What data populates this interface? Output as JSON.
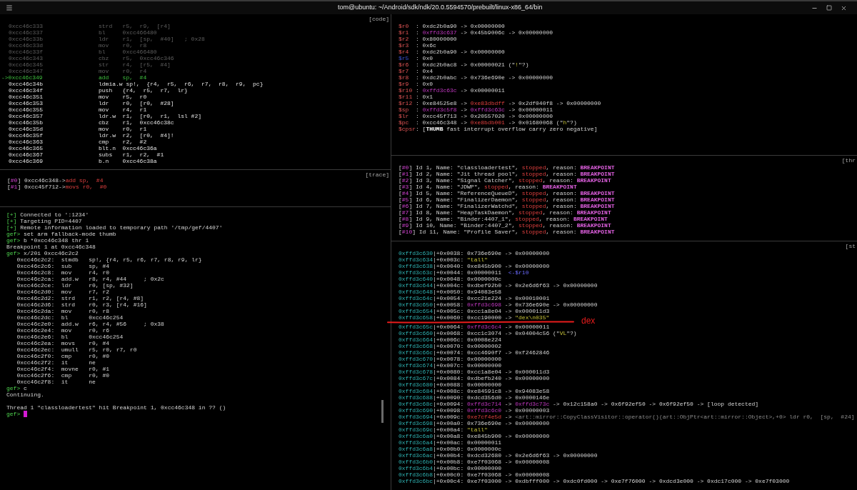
{
  "window": {
    "title": "tom@ubuntu: ~/Android/sdk/ndk/20.0.5594570/prebuilt/linux-x86_64/bin"
  },
  "code_pane": {
    "label": "[code]",
    "lines": [
      {
        "address": "0xcc46c333",
        "instruction": "strd   r5,  r9,  [r4]",
        "kind": "past"
      },
      {
        "address": "0xcc46c337",
        "instruction": "bl     0xcc466480",
        "kind": "past"
      },
      {
        "address": "0xcc46c33b",
        "instruction": "ldr    r1,  [sp,  #40]   ; 0x28",
        "kind": "past"
      },
      {
        "address": "0xcc46c33d",
        "instruction": "mov    r0,  r8",
        "kind": "past"
      },
      {
        "address": "0xcc46c33f",
        "instruction": "bl     0xcc466480",
        "kind": "past"
      },
      {
        "address": "0xcc46c343",
        "instruction": "cbz    r5,  0xcc46c346",
        "kind": "past"
      },
      {
        "address": "0xcc46c345",
        "instruction": "str    r4,  [r5,  #4]",
        "kind": "past"
      },
      {
        "address": "0xcc46c347",
        "instruction": "mov    r0,  r4",
        "kind": "past"
      },
      {
        "address": "->0xcc46c349",
        "instruction": "add    sp,  #4",
        "kind": "current"
      },
      {
        "address": "0xcc46c34b",
        "instruction": "ldmia.w sp!,  {r4,  r5,  r6,  r7,  r8,  r9,  pc}",
        "kind": "next"
      },
      {
        "address": "0xcc46c34f",
        "instruction": "push   {r4,  r5,  r7,  lr}",
        "kind": "next"
      },
      {
        "address": "0xcc46c351",
        "instruction": "mov    r5,  r0",
        "kind": "next"
      },
      {
        "address": "0xcc46c353",
        "instruction": "ldr    r0,  [r0,  #28]",
        "kind": "next"
      },
      {
        "address": "0xcc46c355",
        "instruction": "mov    r4,  r1",
        "kind": "next"
      },
      {
        "address": "0xcc46c357",
        "instruction": "ldr.w  r1,  [r0,  r1,  lsl #2]",
        "kind": "next"
      },
      {
        "address": "0xcc46c35b",
        "instruction": "cbz    r1,  0xcc46c38c",
        "kind": "next"
      },
      {
        "address": "0xcc46c35d",
        "instruction": "mov    r0,  r1",
        "kind": "next"
      },
      {
        "address": "0xcc46c35f",
        "instruction": "ldr.w  r2,  [r0,  #4]!",
        "kind": "next"
      },
      {
        "address": "0xcc46c363",
        "instruction": "cmp    r2,  #2",
        "kind": "next"
      },
      {
        "address": "0xcc46c365",
        "instruction": "blt.n  0xcc46c36a",
        "kind": "next"
      },
      {
        "address": "0xcc46c367",
        "instruction": "subs   r1,  r2,  #1",
        "kind": "next"
      },
      {
        "address": "0xcc46c369",
        "instruction": "b.n    0xcc46c38a",
        "kind": "next"
      }
    ]
  },
  "trace_pane": {
    "label": "[trace]",
    "lines": [
      [
        {
          "kind": "plain",
          "text": "["
        },
        {
          "kind": "index",
          "text": "#0"
        },
        {
          "kind": "plain",
          "text": "] 0xcc46c348->"
        },
        {
          "kind": "code",
          "text": "add sp,  #4"
        }
      ],
      [
        {
          "kind": "plain",
          "text": "["
        },
        {
          "kind": "index",
          "text": "#1"
        },
        {
          "kind": "plain",
          "text": "] 0xcc45f712->"
        },
        {
          "kind": "code",
          "text": "movs r0,  #0"
        }
      ]
    ]
  },
  "console": {
    "lines": [
      [
        {
          "kind": "ok",
          "text": "[+]"
        },
        {
          "kind": "plain",
          "text": " Connected to ':1234'"
        }
      ],
      [
        {
          "kind": "ok",
          "text": "[+]"
        },
        {
          "kind": "plain",
          "text": " Targeting PID=4407"
        }
      ],
      [
        {
          "kind": "ok",
          "text": "[+]"
        },
        {
          "kind": "plain",
          "text": " Remote information loaded to temporary path '/tmp/gef/4407'"
        }
      ],
      [
        {
          "kind": "ok",
          "text": "gef>"
        },
        {
          "kind": "plain",
          "text": " set arm fallback-mode thumb"
        }
      ],
      [
        {
          "kind": "ok",
          "text": "gef>"
        },
        {
          "kind": "plain",
          "text": " b *0xcc46c348 thr 1"
        }
      ],
      [
        {
          "kind": "plain",
          "text": "Breakpoint 1 at 0xcc46c348"
        }
      ],
      [
        {
          "kind": "ok",
          "text": "gef>"
        },
        {
          "kind": "plain",
          "text": " x/20i 0xcc46c2c2"
        }
      ],
      [
        {
          "kind": "plain",
          "text": "   0xcc46c2c2:  stmdb   sp!, {r4, r5, r6, r7, r8, r9, lr}"
        }
      ],
      [
        {
          "kind": "plain",
          "text": "   0xcc46c2c6:  sub     sp, #4"
        }
      ],
      [
        {
          "kind": "plain",
          "text": "   0xcc46c2c8:  mov     r4, r0"
        }
      ],
      [
        {
          "kind": "plain",
          "text": "   0xcc46c2ca:  add.w   r8, r4, #44     ; 0x2c"
        }
      ],
      [
        {
          "kind": "plain",
          "text": "   0xcc46c2ce:  ldr     r0, [sp, #32]"
        }
      ],
      [
        {
          "kind": "plain",
          "text": "   0xcc46c2d0:  mov     r7, r2"
        }
      ],
      [
        {
          "kind": "plain",
          "text": "   0xcc46c2d2:  strd    r1, r2, [r4, #8]"
        }
      ],
      [
        {
          "kind": "plain",
          "text": "   0xcc46c2d6:  strd    r0, r3, [r4, #16]"
        }
      ],
      [
        {
          "kind": "plain",
          "text": "   0xcc46c2da:  mov     r0, r8"
        }
      ],
      [
        {
          "kind": "plain",
          "text": "   0xcc46c2dc:  bl      0xcc46c254"
        }
      ],
      [
        {
          "kind": "plain",
          "text": "   0xcc46c2e0:  add.w   r6, r4, #56     ; 0x38"
        }
      ],
      [
        {
          "kind": "plain",
          "text": "   0xcc46c2e4:  mov     r0, r6"
        }
      ],
      [
        {
          "kind": "plain",
          "text": "   0xcc46c2e6:  bl      0xcc46c254"
        }
      ],
      [
        {
          "kind": "plain",
          "text": "   0xcc46c2ea:  movs    r0, #4"
        }
      ],
      [
        {
          "kind": "plain",
          "text": "   0xcc46c2ec:  umull   r5, r0, r7, r0"
        }
      ],
      [
        {
          "kind": "plain",
          "text": "   0xcc46c2f0:  cmp     r0, #0"
        }
      ],
      [
        {
          "kind": "plain",
          "text": "   0xcc46c2f2:  it      ne"
        }
      ],
      [
        {
          "kind": "plain",
          "text": "   0xcc46c2f4:  movne   r0, #1"
        }
      ],
      [
        {
          "kind": "plain",
          "text": "   0xcc46c2f6:  cmp     r0, #0"
        }
      ],
      [
        {
          "kind": "plain",
          "text": "   0xcc46c2f8:  it      ne"
        }
      ],
      [
        {
          "kind": "ok",
          "text": "gef>"
        },
        {
          "kind": "plain",
          "text": " c"
        }
      ],
      [
        {
          "kind": "plain",
          "text": "Continuing."
        }
      ]
    ],
    "status": [
      {
        "kind": "plain",
        "text": "Thread 1 \"classloadertest\" hit Breakpoint 1, 0xcc46c348 in ?? ()"
      }
    ],
    "prompt": "gef>"
  },
  "registers": {
    "lines": [
      [
        {
          "kind": "reg",
          "text": "$r0  "
        },
        {
          "kind": "plain",
          "text": ": 0xdc2b0a90 -> 0x00000000"
        }
      ],
      [
        {
          "kind": "reg",
          "text": "$r1  "
        },
        {
          "kind": "plain",
          "text": ": "
        },
        {
          "kind": "heap",
          "text": "0xffd3c637"
        },
        {
          "kind": "plain",
          "text": " -> 0x45b9006c -> 0x00000000"
        }
      ],
      [
        {
          "kind": "reg",
          "text": "$r2  "
        },
        {
          "kind": "plain",
          "text": ": 0x80000000"
        }
      ],
      [
        {
          "kind": "reg",
          "text": "$r3  "
        },
        {
          "kind": "plain",
          "text": ": 0x6c"
        }
      ],
      [
        {
          "kind": "reg",
          "text": "$r4  "
        },
        {
          "kind": "plain",
          "text": ": 0xdc2b0a90 -> 0x00000000"
        }
      ],
      [
        {
          "kind": "changed",
          "text": "$r5  "
        },
        {
          "kind": "plain",
          "text": ": 0x0"
        }
      ],
      [
        {
          "kind": "reg",
          "text": "$r6  "
        },
        {
          "kind": "plain",
          "text": ": 0xdc2b0ac8 -> 0x00000021 (\""
        },
        {
          "kind": "string",
          "text": "!"
        },
        {
          "kind": "plain",
          "text": "\"?)"
        }
      ],
      [
        {
          "kind": "reg",
          "text": "$r7  "
        },
        {
          "kind": "plain",
          "text": ": 0x4"
        }
      ],
      [
        {
          "kind": "reg",
          "text": "$r8  "
        },
        {
          "kind": "plain",
          "text": ": 0xdc2b0abc -> 0x736e690e -> 0x00000000"
        }
      ],
      [
        {
          "kind": "reg",
          "text": "$r9  "
        },
        {
          "kind": "plain",
          "text": ": 0x0"
        }
      ],
      [
        {
          "kind": "reg",
          "text": "$r10 "
        },
        {
          "kind": "plain",
          "text": ": "
        },
        {
          "kind": "heap",
          "text": "0xffd3c63c"
        },
        {
          "kind": "plain",
          "text": " -> 0x00000011"
        }
      ],
      [
        {
          "kind": "reg",
          "text": "$r11 "
        },
        {
          "kind": "plain",
          "text": ": 0x1"
        }
      ],
      [
        {
          "kind": "reg",
          "text": "$r12 "
        },
        {
          "kind": "plain",
          "text": ": 0xe84525e8 -> "
        },
        {
          "kind": "code",
          "text": "0xe83dbdff"
        },
        {
          "kind": "plain",
          "text": " -> 0x2df040f8 -> 0x00000000"
        }
      ],
      [
        {
          "kind": "reg",
          "text": "$sp  "
        },
        {
          "kind": "plain",
          "text": ": "
        },
        {
          "kind": "heap",
          "text": "0xffd3c5f8"
        },
        {
          "kind": "plain",
          "text": " -> "
        },
        {
          "kind": "heap",
          "text": "0xffd3c63c"
        },
        {
          "kind": "plain",
          "text": " -> 0x00000011"
        }
      ],
      [
        {
          "kind": "reg",
          "text": "$lr  "
        },
        {
          "kind": "plain",
          "text": ": 0xcc45f713 -> 0x20557020 -> 0x00000000"
        }
      ],
      [
        {
          "kind": "reg",
          "text": "$pc  "
        },
        {
          "kind": "plain",
          "text": ": 0xcc46c348 -> "
        },
        {
          "kind": "code",
          "text": "0xe8bdb001"
        },
        {
          "kind": "plain",
          "text": " -> 0x01680068 (\""
        },
        {
          "kind": "string",
          "text": "h"
        },
        {
          "kind": "plain",
          "text": "\"?)"
        }
      ],
      [
        {
          "kind": "reg",
          "text": "$cpsr"
        },
        {
          "kind": "plain",
          "text": ": ["
        },
        {
          "kind": "bold",
          "text": "THUMB"
        },
        {
          "kind": "plain",
          "text": " fast interrupt overflow carry zero negative]"
        }
      ]
    ]
  },
  "threads": {
    "label": "[thr",
    "lines": [
      [
        {
          "kind": "plain",
          "text": "["
        },
        {
          "kind": "index",
          "text": "#0"
        },
        {
          "kind": "plain",
          "text": "] Id 1, Name: \"classloadertest\", "
        },
        {
          "kind": "code",
          "text": "stopped"
        },
        {
          "kind": "plain",
          "text": ", reason: "
        },
        {
          "kind": "flag",
          "text": "BREAKPOINT"
        }
      ],
      [
        {
          "kind": "plain",
          "text": "["
        },
        {
          "kind": "index",
          "text": "#1"
        },
        {
          "kind": "plain",
          "text": "] Id 2, Name: \"Jit thread pool\", "
        },
        {
          "kind": "code",
          "text": "stopped"
        },
        {
          "kind": "plain",
          "text": ", reason: "
        },
        {
          "kind": "flag",
          "text": "BREAKPOINT"
        }
      ],
      [
        {
          "kind": "plain",
          "text": "["
        },
        {
          "kind": "index",
          "text": "#2"
        },
        {
          "kind": "plain",
          "text": "] Id 3, Name: \"Signal Catcher\", "
        },
        {
          "kind": "code",
          "text": "stopped"
        },
        {
          "kind": "plain",
          "text": ", reason: "
        },
        {
          "kind": "flag",
          "text": "BREAKPOINT"
        }
      ],
      [
        {
          "kind": "plain",
          "text": "["
        },
        {
          "kind": "index",
          "text": "#3"
        },
        {
          "kind": "plain",
          "text": "] Id 4, Name: \"JDWP\", "
        },
        {
          "kind": "code",
          "text": "stopped"
        },
        {
          "kind": "plain",
          "text": ", reason: "
        },
        {
          "kind": "flag",
          "text": "BREAKPOINT"
        }
      ],
      [
        {
          "kind": "plain",
          "text": "["
        },
        {
          "kind": "index",
          "text": "#4"
        },
        {
          "kind": "plain",
          "text": "] Id 5, Name: \"ReferenceQueueD\", "
        },
        {
          "kind": "code",
          "text": "stopped"
        },
        {
          "kind": "plain",
          "text": ", reason: "
        },
        {
          "kind": "flag",
          "text": "BREAKPOINT"
        }
      ],
      [
        {
          "kind": "plain",
          "text": "["
        },
        {
          "kind": "index",
          "text": "#5"
        },
        {
          "kind": "plain",
          "text": "] Id 6, Name: \"FinalizerDaemon\", "
        },
        {
          "kind": "code",
          "text": "stopped"
        },
        {
          "kind": "plain",
          "text": ", reason: "
        },
        {
          "kind": "flag",
          "text": "BREAKPOINT"
        }
      ],
      [
        {
          "kind": "plain",
          "text": "["
        },
        {
          "kind": "index",
          "text": "#6"
        },
        {
          "kind": "plain",
          "text": "] Id 7, Name: \"FinalizerWatchd\", "
        },
        {
          "kind": "code",
          "text": "stopped"
        },
        {
          "kind": "plain",
          "text": ", reason: "
        },
        {
          "kind": "flag",
          "text": "BREAKPOINT"
        }
      ],
      [
        {
          "kind": "plain",
          "text": "["
        },
        {
          "kind": "index",
          "text": "#7"
        },
        {
          "kind": "plain",
          "text": "] Id 8, Name: \"HeapTaskDaemon\", "
        },
        {
          "kind": "code",
          "text": "stopped"
        },
        {
          "kind": "plain",
          "text": ", reason: "
        },
        {
          "kind": "flag",
          "text": "BREAKPOINT"
        }
      ],
      [
        {
          "kind": "plain",
          "text": "["
        },
        {
          "kind": "index",
          "text": "#8"
        },
        {
          "kind": "plain",
          "text": "] Id 9, Name: \"Binder:4407_1\", "
        },
        {
          "kind": "code",
          "text": "stopped"
        },
        {
          "kind": "plain",
          "text": ", reason: "
        },
        {
          "kind": "flag",
          "text": "BREAKPOINT"
        }
      ],
      [
        {
          "kind": "plain",
          "text": "["
        },
        {
          "kind": "index",
          "text": "#9"
        },
        {
          "kind": "plain",
          "text": "] Id 10, Name: \"Binder:4407_2\", "
        },
        {
          "kind": "code",
          "text": "stopped"
        },
        {
          "kind": "plain",
          "text": ", reason: "
        },
        {
          "kind": "flag",
          "text": "BREAKPOINT"
        }
      ],
      [
        {
          "kind": "plain",
          "text": "["
        },
        {
          "kind": "index",
          "text": "#10"
        },
        {
          "kind": "plain",
          "text": "] Id 11, Name: \"Profile Saver\", "
        },
        {
          "kind": "code",
          "text": "stopped"
        },
        {
          "kind": "plain",
          "text": ", reason: "
        },
        {
          "kind": "flag",
          "text": "BREAKPOINT"
        }
      ]
    ]
  },
  "stack": {
    "label": "[st",
    "lines": [
      {
        "address": "0xffd3c630",
        "offset": "|+0x0038: ",
        "segments": [
          {
            "kind": "plain",
            "text": "0x736e690e -> 0x00000000"
          }
        ]
      },
      {
        "address": "0xffd3c634",
        "offset": "|+0x003c: ",
        "segments": [
          {
            "kind": "string",
            "text": "\"tall\""
          }
        ]
      },
      {
        "address": "0xffd3c638",
        "offset": "|+0x0040: ",
        "segments": [
          {
            "kind": "plain",
            "text": "0xe845b900 -> 0x00000000"
          }
        ]
      },
      {
        "address": "0xffd3c63c",
        "offset": "|+0x0044: ",
        "segments": [
          {
            "kind": "plain",
            "text": "0x00000011  "
          },
          {
            "kind": "note",
            "text": "<-$r10"
          }
        ]
      },
      {
        "address": "0xffd3c640",
        "offset": "|+0x0048: ",
        "segments": [
          {
            "kind": "plain",
            "text": "0x0000000c"
          }
        ]
      },
      {
        "address": "0xffd3c644",
        "offset": "|+0x004c: ",
        "segments": [
          {
            "kind": "plain",
            "text": "0xdbef92b0 -> 0x2e6d6f63 -> 0x00000000"
          }
        ]
      },
      {
        "address": "0xffd3c648",
        "offset": "|+0x0050: ",
        "segments": [
          {
            "kind": "plain",
            "text": "0x94083e58"
          }
        ]
      },
      {
        "address": "0xffd3c64c",
        "offset": "|+0x0054: ",
        "segments": [
          {
            "kind": "plain",
            "text": "0xcc21e224 -> 0x00010001"
          }
        ]
      },
      {
        "address": "0xffd3c650",
        "offset": "|+0x0058: ",
        "segments": [
          {
            "kind": "heap",
            "text": "0xffd3c698"
          },
          {
            "kind": "plain",
            "text": " -> 0x736e690e -> 0x00000000"
          }
        ]
      },
      {
        "address": "0xffd3c654",
        "offset": "|+0x005c: ",
        "segments": [
          {
            "kind": "plain",
            "text": "0xcc1a8e04 -> 0x000011d3"
          }
        ]
      },
      {
        "address": "0xffd3c658",
        "offset": "|+0x0060: ",
        "segments": [
          {
            "kind": "plain",
            "text": "0xcc190000 -> "
          },
          {
            "kind": "string",
            "text": "\"dex\\n035\""
          }
        ]
      }
    ],
    "annotation": {
      "text": "dex"
    },
    "lines_after": [
      {
        "address": "0xffd3c65c",
        "offset": "|+0x0064: ",
        "segments": [
          {
            "kind": "heap",
            "text": "0xffd3c6c4"
          },
          {
            "kind": "plain",
            "text": " -> 0x00000011"
          }
        ]
      },
      {
        "address": "0xffd3c660",
        "offset": "|+0x0068: ",
        "segments": [
          {
            "kind": "plain",
            "text": "0xcc1c3074 -> 0x04004c56 (\""
          },
          {
            "kind": "string",
            "text": "VL"
          },
          {
            "kind": "plain",
            "text": "\"?)"
          }
        ]
      },
      {
        "address": "0xffd3c664",
        "offset": "|+0x006c: ",
        "segments": [
          {
            "kind": "plain",
            "text": "0x0008e224"
          }
        ]
      },
      {
        "address": "0xffd3c668",
        "offset": "|+0x0070: ",
        "segments": [
          {
            "kind": "plain",
            "text": "0x00000002"
          }
        ]
      },
      {
        "address": "0xffd3c66c",
        "offset": "|+0x0074: ",
        "segments": [
          {
            "kind": "plain",
            "text": "0xcc4690f7 -> 0xf2462846"
          }
        ]
      },
      {
        "address": "0xffd3c670",
        "offset": "|+0x0078: ",
        "segments": [
          {
            "kind": "plain",
            "text": "0x00000000"
          }
        ]
      },
      {
        "address": "0xffd3c674",
        "offset": "|+0x007c: ",
        "segments": [
          {
            "kind": "plain",
            "text": "0x00000000"
          }
        ]
      },
      {
        "address": "0xffd3c678",
        "offset": "|+0x0080: ",
        "segments": [
          {
            "kind": "plain",
            "text": "0xcc1a8e04 -> 0x000011d3"
          }
        ]
      },
      {
        "address": "0xffd3c67c",
        "offset": "|+0x0084: ",
        "segments": [
          {
            "kind": "plain",
            "text": "0xdbefb240 -> 0x00000000"
          }
        ]
      },
      {
        "address": "0xffd3c680",
        "offset": "|+0x0088: ",
        "segments": [
          {
            "kind": "plain",
            "text": "0x00000000"
          }
        ]
      },
      {
        "address": "0xffd3c684",
        "offset": "|+0x008c: ",
        "segments": [
          {
            "kind": "plain",
            "text": "0xe84591c8 -> 0x94083e58"
          }
        ]
      },
      {
        "address": "0xffd3c688",
        "offset": "|+0x0090: ",
        "segments": [
          {
            "kind": "plain",
            "text": "0xdcd356d0 -> 0x0000146e"
          }
        ]
      },
      {
        "address": "0xffd3c68c",
        "offset": "|+0x0094: ",
        "segments": [
          {
            "kind": "heap",
            "text": "0xffd3c714"
          },
          {
            "kind": "plain",
            "text": " -> "
          },
          {
            "kind": "heap",
            "text": "0xffd3c73c"
          },
          {
            "kind": "plain",
            "text": " -> 0x12c158a0 -> 0x6f92ef50 -> 0x6f92ef50 -> [loop detected]"
          }
        ]
      },
      {
        "address": "0xffd3c690",
        "offset": "|+0x0098: ",
        "segments": [
          {
            "kind": "heap",
            "text": "0xffd3c6c0"
          },
          {
            "kind": "plain",
            "text": " -> 0x00000003"
          }
        ]
      },
      {
        "address": "0xffd3c694",
        "offset": "|+0x009c: ",
        "segments": [
          {
            "kind": "code",
            "text": "0xe7cf4e5d"
          },
          {
            "kind": "plain",
            "text": " -> "
          },
          {
            "kind": "comment",
            "text": "<art::mirror::CopyClassVisitor::operator()(art::ObjPtr<art::mirror::Object>,+0> ldr r0,  [sp,  #24]"
          }
        ]
      },
      {
        "address": "0xffd3c698",
        "offset": "|+0x00a0: ",
        "segments": [
          {
            "kind": "plain",
            "text": "0x736e690e -> 0x00000000"
          }
        ]
      },
      {
        "address": "0xffd3c69c",
        "offset": "|+0x00a4: ",
        "segments": [
          {
            "kind": "string",
            "text": "\"tall\""
          }
        ]
      },
      {
        "address": "0xffd3c6a0",
        "offset": "|+0x00a8: ",
        "segments": [
          {
            "kind": "plain",
            "text": "0xe845b900 -> 0x00000000"
          }
        ]
      },
      {
        "address": "0xffd3c6a4",
        "offset": "|+0x00ac: ",
        "segments": [
          {
            "kind": "plain",
            "text": "0x00000011"
          }
        ]
      },
      {
        "address": "0xffd3c6a8",
        "offset": "|+0x00b0: ",
        "segments": [
          {
            "kind": "plain",
            "text": "0x0000000c"
          }
        ]
      },
      {
        "address": "0xffd3c6ac",
        "offset": "|+0x00b4: ",
        "segments": [
          {
            "kind": "plain",
            "text": "0xdcd32680 -> 0x2e6d6f63 -> 0x00000000"
          }
        ]
      },
      {
        "address": "0xffd3c6b0",
        "offset": "|+0x00b8: ",
        "segments": [
          {
            "kind": "plain",
            "text": "0xe7f03068 -> 0x00000008"
          }
        ]
      },
      {
        "address": "0xffd3c6b4",
        "offset": "|+0x00bc: ",
        "segments": [
          {
            "kind": "plain",
            "text": "0x00000000"
          }
        ]
      },
      {
        "address": "0xffd3c6b8",
        "offset": "|+0x00c0: ",
        "segments": [
          {
            "kind": "plain",
            "text": "0xe7f03068 -> 0x00000008"
          }
        ]
      },
      {
        "address": "0xffd3c6bc",
        "offset": "|+0x00c4: ",
        "segments": [
          {
            "kind": "plain",
            "text": "0xe7f03000 -> 0xdbfff000 -> 0xdc0fd000 -> 0xe7f76000 -> 0xdcd3e000 -> 0xdc17c000 -> 0xe7f03000"
          }
        ]
      }
    ]
  }
}
